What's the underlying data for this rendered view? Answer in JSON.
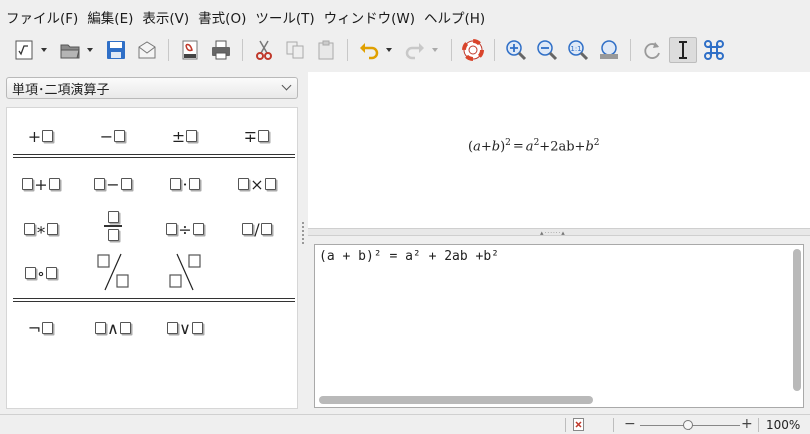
{
  "menu": [
    "ファイル(F)",
    "編集(E)",
    "表示(V)",
    "書式(O)",
    "ツール(T)",
    "ウィンドウ(W)",
    "ヘルプ(H)"
  ],
  "toolbar": {
    "icons": [
      "formula-edit-icon",
      "open-folder-icon",
      "save-icon",
      "email-icon",
      "export-pdf-icon",
      "print-icon",
      "cut-icon",
      "copy-icon",
      "paste-icon",
      "undo-icon",
      "redo-icon",
      "help-lifebuoy-icon",
      "zoom-in-icon",
      "zoom-out-icon",
      "zoom-100-icon",
      "show-all-icon",
      "update-icon",
      "formula-cursor-icon",
      "symbols-icon"
    ]
  },
  "category_select": {
    "value": "単項･二項演算子"
  },
  "palette": {
    "unary": [
      {
        "name": "op-plus",
        "sym": "+"
      },
      {
        "name": "op-minus",
        "sym": "−"
      },
      {
        "name": "op-plus-minus",
        "sym": "±"
      },
      {
        "name": "op-minus-plus",
        "sym": "∓"
      }
    ],
    "binary": [
      {
        "name": "op-add",
        "sym": "+"
      },
      {
        "name": "op-subtract",
        "sym": "−"
      },
      {
        "name": "op-cdot",
        "sym": "·"
      },
      {
        "name": "op-times",
        "sym": "×"
      },
      {
        "name": "op-asterisk",
        "sym": "∗"
      },
      {
        "name": "op-fraction",
        "sym": ""
      },
      {
        "name": "op-divide",
        "sym": "÷"
      },
      {
        "name": "op-slash",
        "sym": "/"
      },
      {
        "name": "op-circ",
        "sym": "∘"
      },
      {
        "name": "op-wideslash",
        "sym": ""
      },
      {
        "name": "op-widebslash",
        "sym": ""
      }
    ],
    "logic": [
      {
        "name": "op-not",
        "sym": "¬"
      },
      {
        "name": "op-and",
        "sym": "∧"
      },
      {
        "name": "op-or",
        "sym": "∨"
      }
    ]
  },
  "preview": {
    "lparen": "(",
    "a": "a",
    "plus": "+",
    "b": "b",
    "rparen": ")",
    "sq1": "2",
    "equals": "=",
    "a2": "a",
    "sq2": "2",
    "plus2": "+",
    "twoab": "2ab",
    "plus3": "+",
    "b2": "b",
    "sq3": "2"
  },
  "command": "(a + b)² = a² + 2ab +b²",
  "status": {
    "zoom": "100%"
  },
  "colors": {
    "accent_blue": "#2f6fc7",
    "window_bg": "#efefef",
    "red": "#c0392b"
  }
}
